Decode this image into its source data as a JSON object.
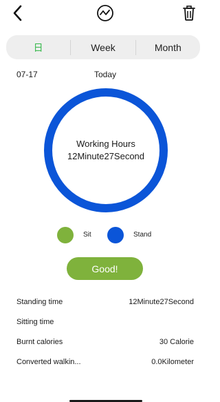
{
  "header": {
    "back_icon": "chevron-left-icon",
    "trend_icon": "trend-chart-icon",
    "trash_icon": "trash-icon"
  },
  "tabs": [
    {
      "label": "日",
      "active": true
    },
    {
      "label": "Week",
      "active": false
    },
    {
      "label": "Month",
      "active": false
    }
  ],
  "date": {
    "left": "07-17",
    "center": "Today"
  },
  "ring": {
    "label": "Working Hours",
    "value": "12Minute27Second",
    "color": "#0b55d8"
  },
  "legend": [
    {
      "label": "Sit",
      "color": "#7fb23c"
    },
    {
      "label": "Stand",
      "color": "#0b55d8"
    }
  ],
  "status_button": {
    "label": "Good!",
    "color": "#7fb23c"
  },
  "stats": [
    {
      "label": "Standing time",
      "value": "12Minute27Second"
    },
    {
      "label": "Sitting time",
      "value": ""
    },
    {
      "label": "Burnt calories",
      "value": "30 Calorie"
    },
    {
      "label": "Converted walkin...",
      "value": "0.0Kilometer"
    }
  ]
}
